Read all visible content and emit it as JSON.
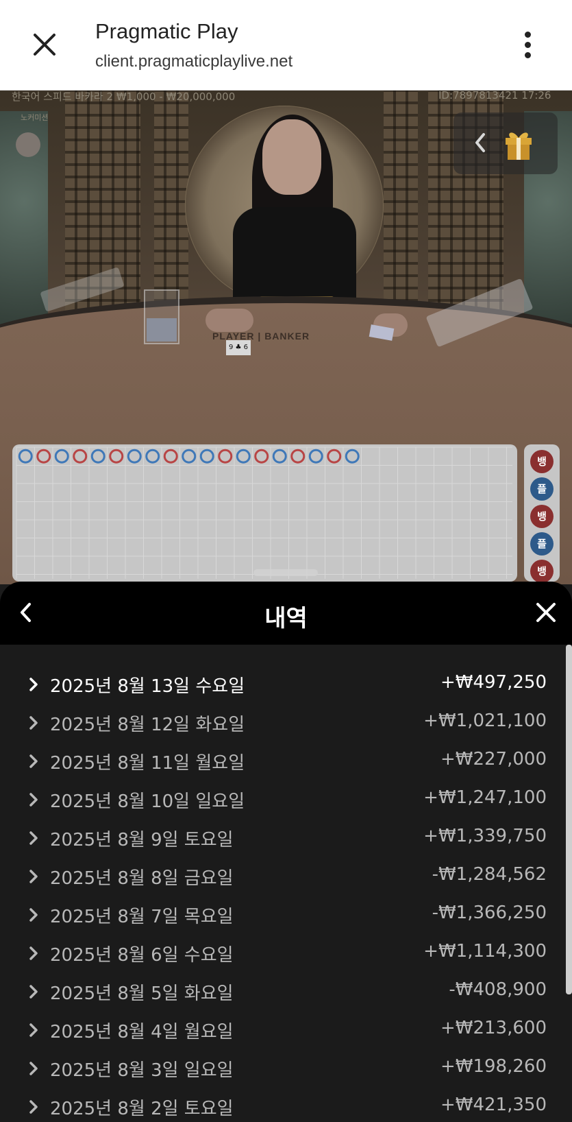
{
  "browser": {
    "title": "Pragmatic Play",
    "url": "client.pragmaticplaylive.net"
  },
  "game": {
    "table_info": "한국어 스피드 바카라 2 ₩1,000 - ₩20,000,000",
    "sub_label": "노커미션",
    "round_info": "ID:7897813421 17:26",
    "table_label": "PLAYER | BANKER",
    "card_text": "9 ♣ 6"
  },
  "roadmap": {
    "colors": {
      "banker": "#b84545",
      "player": "#3f78b8",
      "grid": "#d6d6d6"
    },
    "bead_top_row": [
      "P",
      "B",
      "P",
      "B",
      "P",
      "B",
      "P",
      "P",
      "B",
      "P",
      "P",
      "B",
      "P",
      "B",
      "P",
      "B",
      "P",
      "B",
      "P"
    ],
    "side_badges": [
      {
        "label": "뱅",
        "type": "banker"
      },
      {
        "label": "플",
        "type": "player"
      },
      {
        "label": "뱅",
        "type": "banker"
      },
      {
        "label": "플",
        "type": "player"
      },
      {
        "label": "뱅",
        "type": "banker"
      }
    ]
  },
  "history": {
    "title": "내역",
    "rows": [
      {
        "date": "2025년 8월 13일 수요일",
        "amount": "+₩497,250",
        "active": true
      },
      {
        "date": "2025년 8월 12일 화요일",
        "amount": "+₩1,021,100"
      },
      {
        "date": "2025년 8월 11일 월요일",
        "amount": "+₩227,000"
      },
      {
        "date": "2025년 8월 10일 일요일",
        "amount": "+₩1,247,100"
      },
      {
        "date": "2025년 8월 9일 토요일",
        "amount": "+₩1,339,750"
      },
      {
        "date": "2025년 8월 8일 금요일",
        "amount": "-₩1,284,562"
      },
      {
        "date": "2025년 8월 7일 목요일",
        "amount": "-₩1,366,250"
      },
      {
        "date": "2025년 8월 6일 수요일",
        "amount": "+₩1,114,300"
      },
      {
        "date": "2025년 8월 5일 화요일",
        "amount": "-₩408,900"
      },
      {
        "date": "2025년 8월 4일 월요일",
        "amount": "+₩213,600"
      },
      {
        "date": "2025년 8월 3일 일요일",
        "amount": "+₩198,260"
      },
      {
        "date": "2025년 8월 2일 토요일",
        "amount": "+₩421,350"
      }
    ]
  },
  "icons": {
    "browser_close": "close-icon",
    "browser_menu": "more-vertical-icon",
    "promo_chevron": "chevron-left-icon",
    "gift": "gift-icon",
    "back": "chevron-left-icon",
    "close": "close-icon",
    "row": "chevron-right-icon"
  }
}
